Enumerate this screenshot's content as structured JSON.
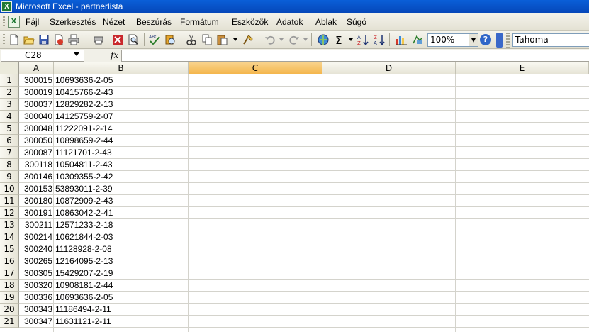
{
  "window": {
    "title": "Microsoft Excel - partnerlista"
  },
  "menu": [
    "Fájl",
    "Szerkesztés",
    "Nézet",
    "Beszúrás",
    "Formátum",
    "Eszközök",
    "Adatok",
    "Ablak",
    "Súgó"
  ],
  "toolbar": {
    "zoom": "100%",
    "font": "Tahoma",
    "icons": [
      "new-icon",
      "open-icon",
      "save-icon",
      "permission-icon",
      "print-icon",
      "print-preview-icon",
      "research-icon",
      "spelling-icon",
      "research-book-icon",
      "cut-icon",
      "copy-icon",
      "paste-icon",
      "format-painter-icon",
      "undo-icon",
      "redo-icon",
      "hyperlink-icon",
      "autosum-icon",
      "sort-ascending-icon",
      "sort-descending-icon",
      "chart-wizard-icon",
      "drawing-icon"
    ]
  },
  "formula_bar": {
    "name_box": "C28",
    "fx": "fx",
    "value": ""
  },
  "sheet": {
    "columns": [
      "A",
      "B",
      "C",
      "D",
      "E"
    ],
    "selected_column": "C",
    "rows": [
      {
        "n": "1",
        "a": "300015",
        "b": "10693636-2-05"
      },
      {
        "n": "2",
        "a": "300019",
        "b": "10415766-2-43"
      },
      {
        "n": "3",
        "a": "300037",
        "b": "12829282-2-13"
      },
      {
        "n": "4",
        "a": "300040",
        "b": "14125759-2-07"
      },
      {
        "n": "5",
        "a": "300048",
        "b": "11222091-2-14"
      },
      {
        "n": "6",
        "a": "300050",
        "b": "10898659-2-44"
      },
      {
        "n": "7",
        "a": "300087",
        "b": "11121701-2-43"
      },
      {
        "n": "8",
        "a": "300118",
        "b": "10504811-2-43"
      },
      {
        "n": "9",
        "a": "300146",
        "b": "10309355-2-42"
      },
      {
        "n": "10",
        "a": "300153",
        "b": "53893011-2-39"
      },
      {
        "n": "11",
        "a": "300180",
        "b": "10872909-2-43"
      },
      {
        "n": "12",
        "a": "300191",
        "b": "10863042-2-41"
      },
      {
        "n": "13",
        "a": "300211",
        "b": "12571233-2-18"
      },
      {
        "n": "14",
        "a": "300214",
        "b": "10621844-2-03"
      },
      {
        "n": "15",
        "a": "300240",
        "b": "11128928-2-08"
      },
      {
        "n": "16",
        "a": "300265",
        "b": "12164095-2-13"
      },
      {
        "n": "17",
        "a": "300305",
        "b": "15429207-2-19"
      },
      {
        "n": "18",
        "a": "300320",
        "b": "10908181-2-44"
      },
      {
        "n": "19",
        "a": "300336",
        "b": "10693636-2-05"
      },
      {
        "n": "20",
        "a": "300343",
        "b": "11186494-2-11"
      },
      {
        "n": "21",
        "a": "300347",
        "b": "11631121-2-11"
      }
    ]
  }
}
